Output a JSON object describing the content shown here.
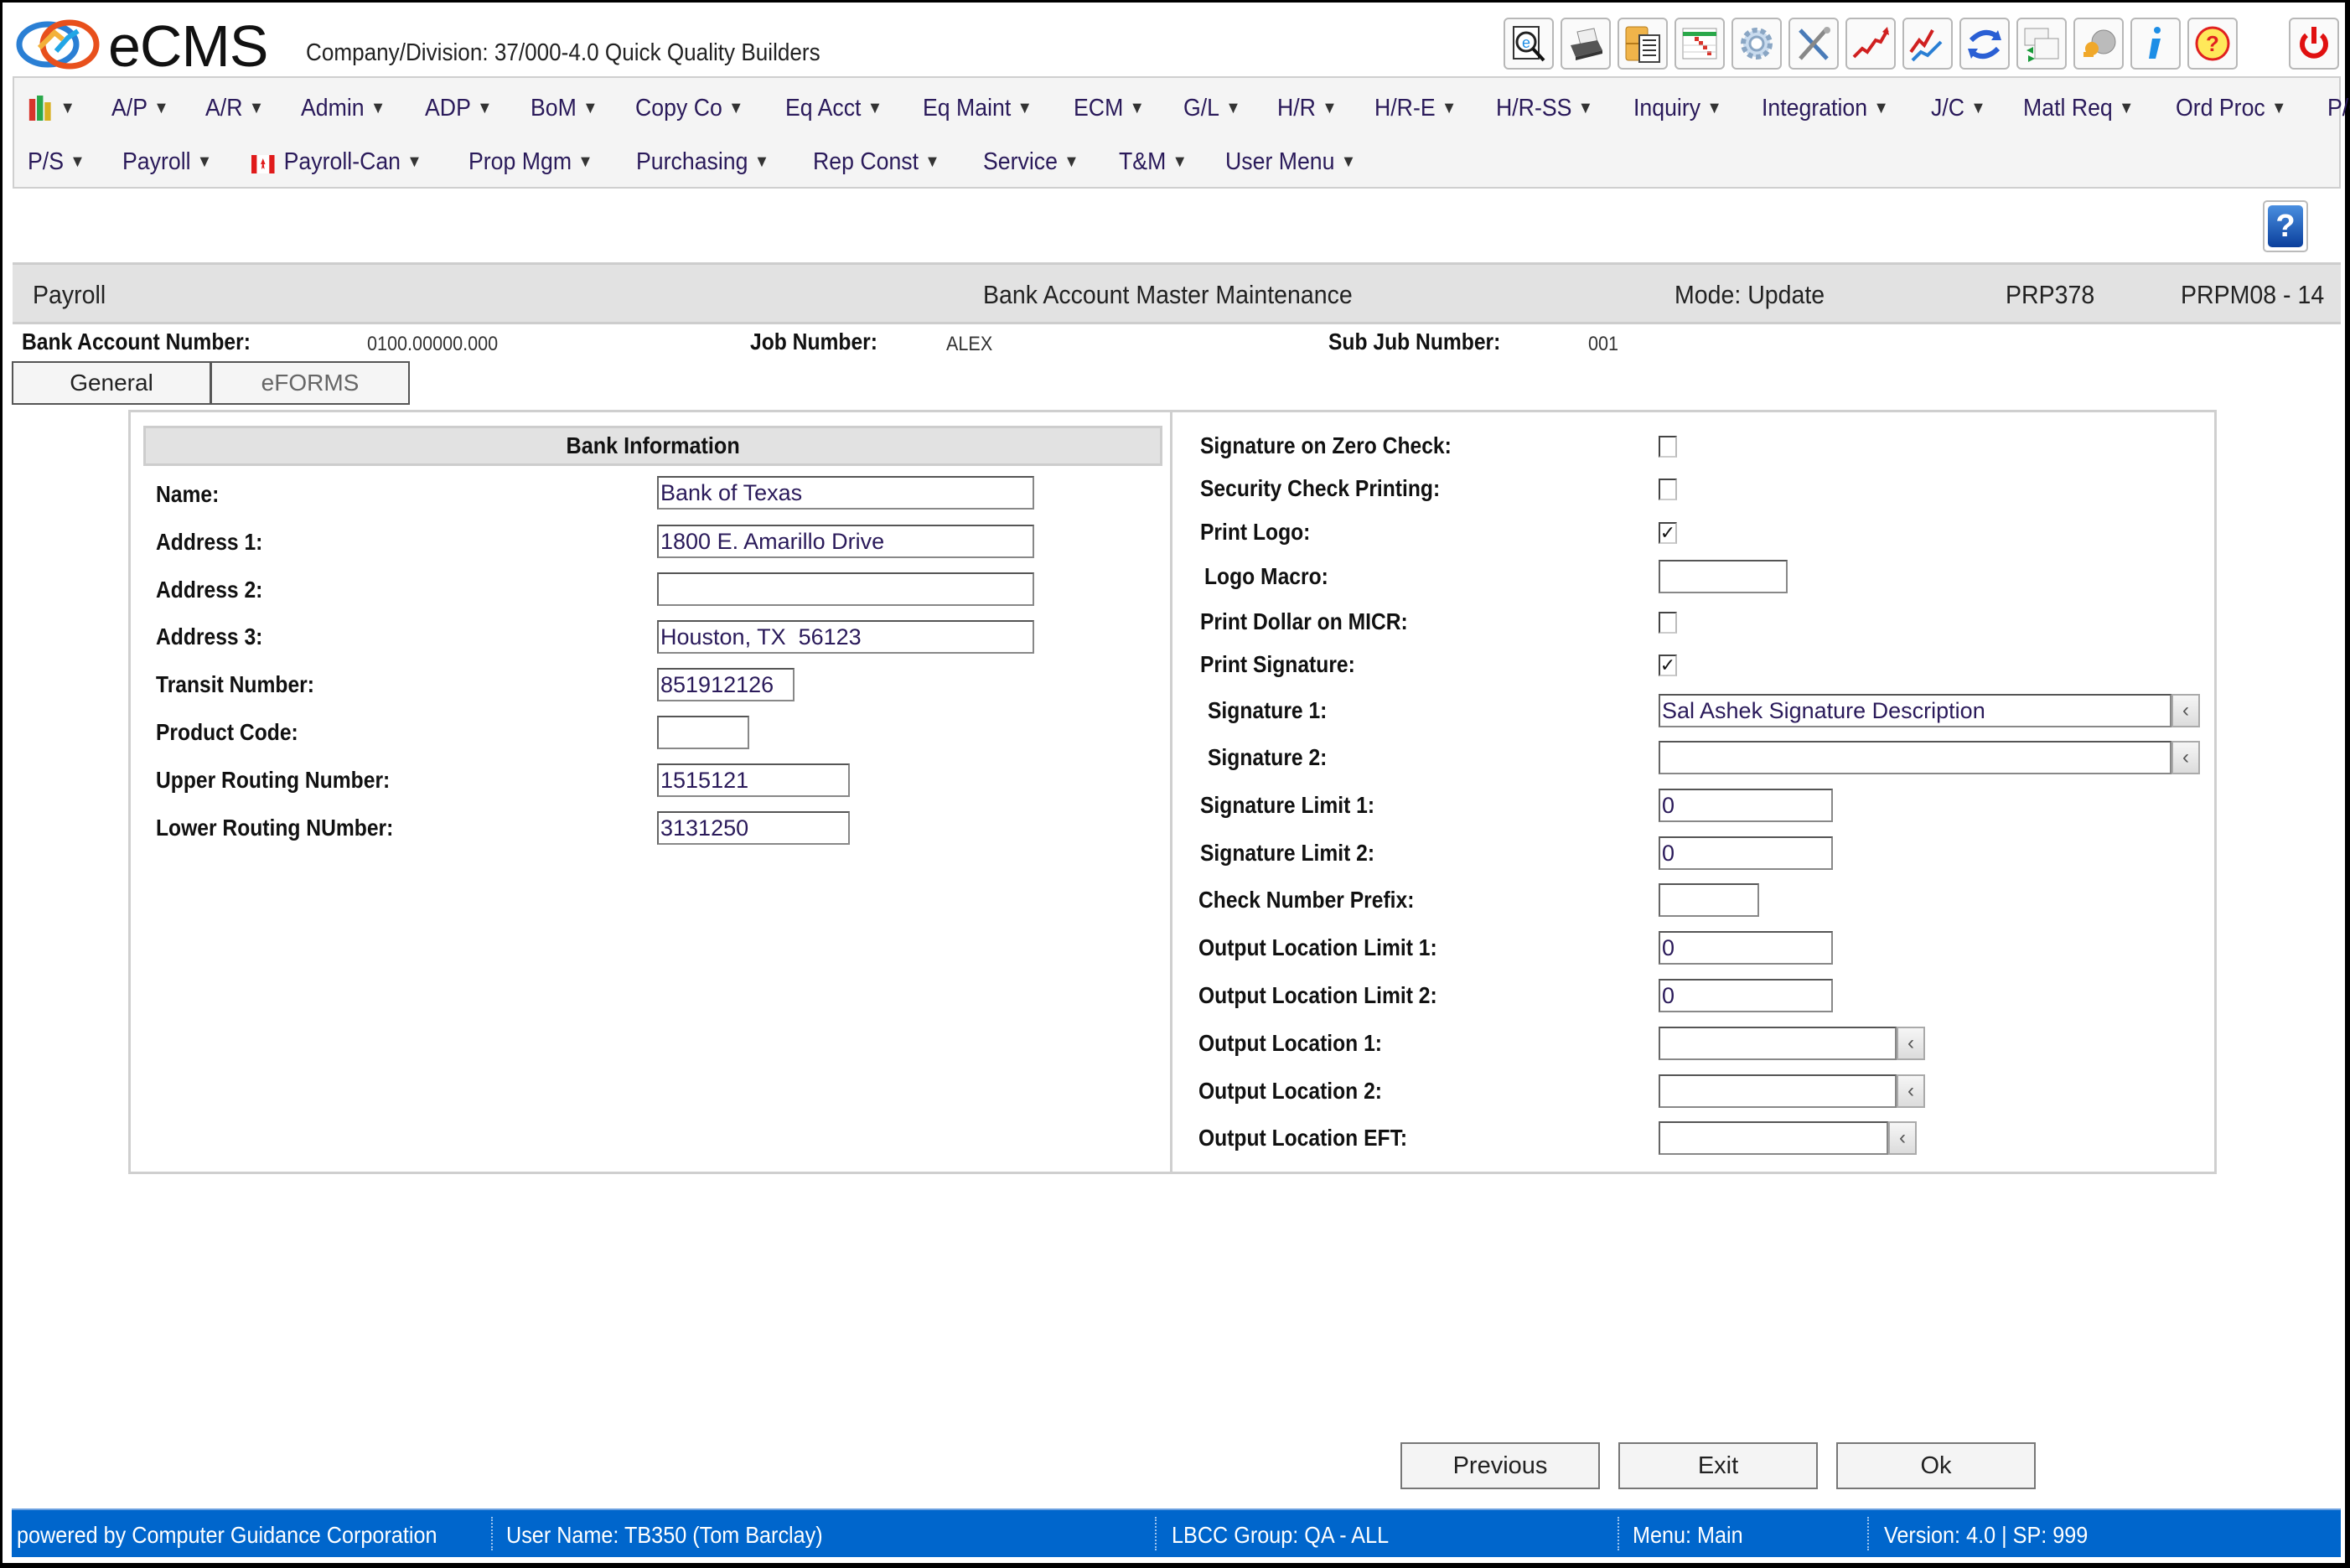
{
  "app": {
    "logo_text": "eCMS",
    "company_label": "Company/Division:",
    "company_value": "37/000-4.0 Quick Quality Builders"
  },
  "toolbar": {
    "icons": [
      {
        "name": "document-search-icon"
      },
      {
        "name": "printer-icon"
      },
      {
        "name": "file-cabinet-icon"
      },
      {
        "name": "spreadsheet-icon"
      },
      {
        "name": "gear-icon"
      },
      {
        "name": "tools-icon"
      },
      {
        "name": "trend-chart-icon"
      },
      {
        "name": "compare-chart-icon"
      },
      {
        "name": "refresh-icon"
      },
      {
        "name": "window-switch-icon"
      },
      {
        "name": "keys-icon"
      },
      {
        "name": "info-icon"
      },
      {
        "name": "help-icon"
      }
    ],
    "power_icon": "power-icon"
  },
  "menu": {
    "row1": [
      "A/P",
      "A/R",
      "Admin",
      "ADP",
      "BoM",
      "Copy Co",
      "Eq Acct",
      "Eq Maint",
      "ECM",
      "G/L",
      "H/R",
      "H/R-E",
      "H/R-SS",
      "Inquiry",
      "Integration",
      "J/C",
      "Matl Req",
      "Ord Proc",
      "P/C"
    ],
    "row2": [
      "P/S",
      "Payroll",
      "Payroll-Can",
      "Prop Mgm",
      "Purchasing",
      "Rep Const",
      "Service",
      "T&M",
      "User Menu"
    ],
    "arrow": "▼"
  },
  "titlebar": {
    "module": "Payroll",
    "title": "Bank Account Master Maintenance",
    "mode": "Mode: Update",
    "program": "PRP378",
    "screen": "PRPM08 - 14"
  },
  "header_fields": {
    "bank_account_label": "Bank Account Number:",
    "bank_account_value": "0100.00000.000",
    "job_label": "Job Number:",
    "job_value": "ALEX",
    "subjob_label": "Sub Jub Number:",
    "subjob_value": "001"
  },
  "tabs": [
    {
      "label": "General",
      "active": true
    },
    {
      "label": "eFORMS",
      "active": false
    }
  ],
  "bank_info": {
    "title": "Bank Information",
    "fields": [
      {
        "label": "Name:",
        "value": ""
      },
      {
        "label": "Address 1:",
        "value": ""
      },
      {
        "label": "Address 2:",
        "value": ""
      },
      {
        "label": "Address 3:",
        "value": ""
      },
      {
        "label": "Transit Number:",
        "value": ""
      },
      {
        "label": "Product Code:",
        "value": ""
      },
      {
        "label": "Upper Routing Number:",
        "value": ""
      },
      {
        "label": "Lower Routing NUmber:",
        "value": ""
      }
    ],
    "values": {
      "name": "Bank of Texas",
      "address1": "1800 E. Amarillo Drive",
      "address2": "",
      "address3": "Houston, TX  56123",
      "transit": "851912126",
      "product_code": "",
      "upper_routing": "1515121",
      "lower_routing": "3131250"
    }
  },
  "check_options": {
    "labels": {
      "sig_zero": "Signature on Zero Check:",
      "security": "Security Check Printing:",
      "print_logo": "Print Logo:",
      "logo_macro": "Logo Macro:",
      "dollar_micr": "Print Dollar on MICR:",
      "print_sig": "Print Signature:",
      "sig1": "Signature 1:",
      "sig2": "Signature 2:",
      "sig_limit1": "Signature Limit 1:",
      "sig_limit2": "Signature Limit 2:",
      "check_prefix": "Check Number Prefix:",
      "out_limit1": "Output Location Limit 1:",
      "out_limit2": "Output Location Limit 2:",
      "out_loc1": "Output Location 1:",
      "out_loc2": "Output Location 2:",
      "out_eft": "Output Location EFT:"
    },
    "checked": {
      "sig_zero": false,
      "security": false,
      "print_logo": true,
      "dollar_micr": false,
      "print_sig": true
    },
    "values": {
      "logo_macro": "",
      "sig1": "Sal Ashek Signature Description",
      "sig2": "",
      "sig_limit1": "0",
      "sig_limit2": "0",
      "check_prefix": "",
      "out_limit1": "0",
      "out_limit2": "0",
      "out_loc1": "",
      "out_loc2": "",
      "out_eft": ""
    },
    "check_mark": "✓",
    "lookup_glyph": "‹"
  },
  "actions": {
    "previous": "Previous",
    "exit": "Exit",
    "ok": "Ok"
  },
  "help_glyph": "?",
  "statusbar": {
    "powered": "powered by Computer Guidance Corporation",
    "user": "User Name:  TB350 (Tom Barclay)",
    "group": "LBCC Group:  QA - ALL",
    "menu": "Menu:  Main",
    "version": "Version: 4.0 | SP: 999"
  },
  "colors": {
    "statusbar": "#0066cc",
    "menu_text": "#2a1a5a",
    "titlebar_bg": "#e2e2e2"
  }
}
